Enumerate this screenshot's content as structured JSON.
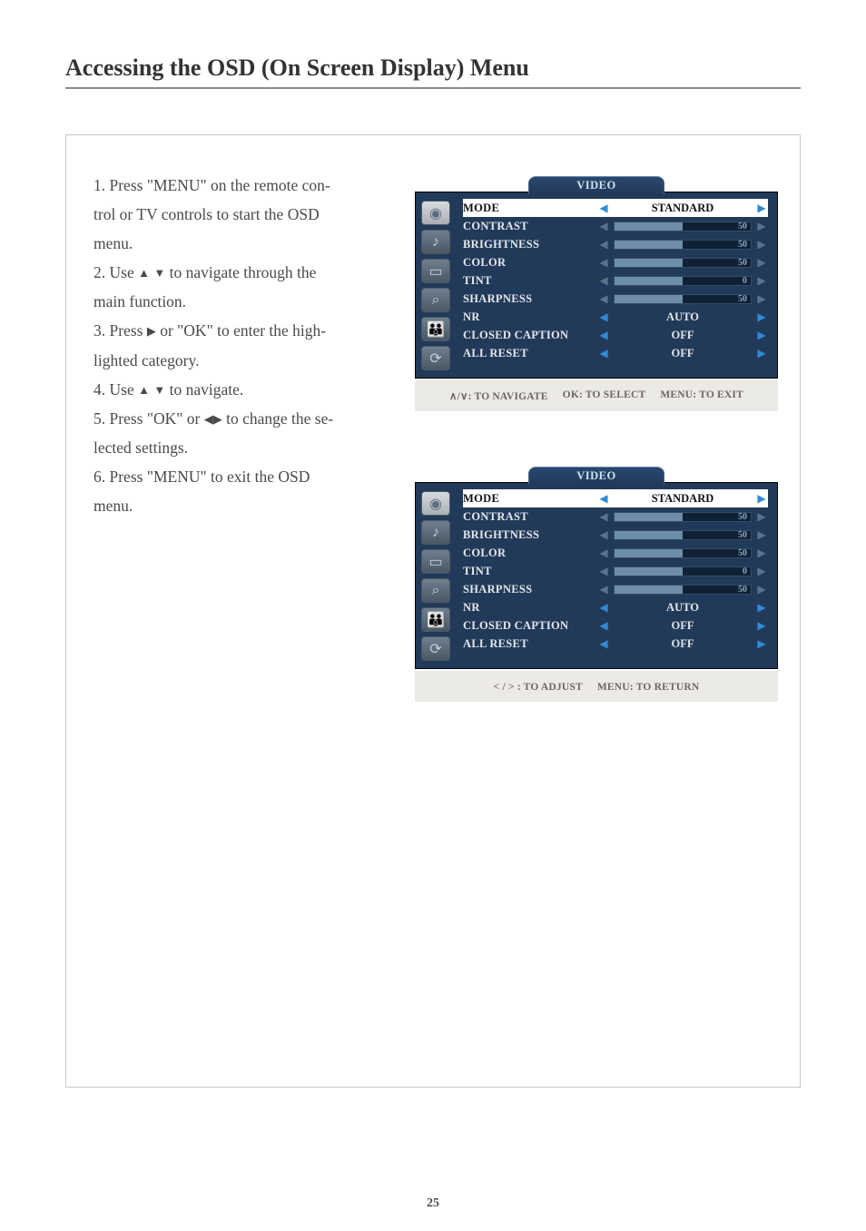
{
  "page": {
    "title": "Accessing the OSD (On Screen Display) Menu",
    "number": "25"
  },
  "instructions": {
    "i1a": "1. Press \"MENU\" on the remote con-",
    "i1b": "trol or TV controls to start the  OSD",
    "i1c": "menu.",
    "i2a": "2. Use ",
    "i2b": " to navigate through the",
    "i2c": "main function.",
    "i3a": "3. Press ",
    "i3b": " or \"OK\" to enter the high-",
    "i3c": "lighted category.",
    "i4a": "4. Use ",
    "i4b": " to navigate.",
    "i5a": "5. Press \"OK\" or  ",
    "i5b": " to change the se-",
    "i5c": "lected settings.",
    "i6a": "6. Press \"MENU\" to exit the OSD",
    "i6b": "menu."
  },
  "glyph": {
    "up": "▲",
    "down": "▼",
    "left": "◀",
    "right": "▶"
  },
  "osd": {
    "tab": "VIDEO",
    "rows": {
      "mode": "MODE",
      "contrast": "CONTRAST",
      "brightness": "BRIGHTNESS",
      "color": "COLOR",
      "tint": "TINT",
      "sharpness": "SHARPNESS",
      "nr": "NR",
      "cc": "CLOSED CAPTION",
      "reset": "ALL RESET"
    },
    "vals": {
      "mode": "STANDARD",
      "contrast": "50",
      "brightness": "50",
      "color": "50",
      "tint": "0",
      "sharpness": "50",
      "nr": "AUTO",
      "cc": "OFF",
      "reset": "OFF"
    }
  },
  "hint1": {
    "a": "∧/∨: TO NAVIGATE",
    "b": "OK: TO SELECT",
    "c": "MENU: TO EXIT"
  },
  "hint2": {
    "a": "< / > : TO ADJUST",
    "b": "MENU: TO RETURN"
  }
}
